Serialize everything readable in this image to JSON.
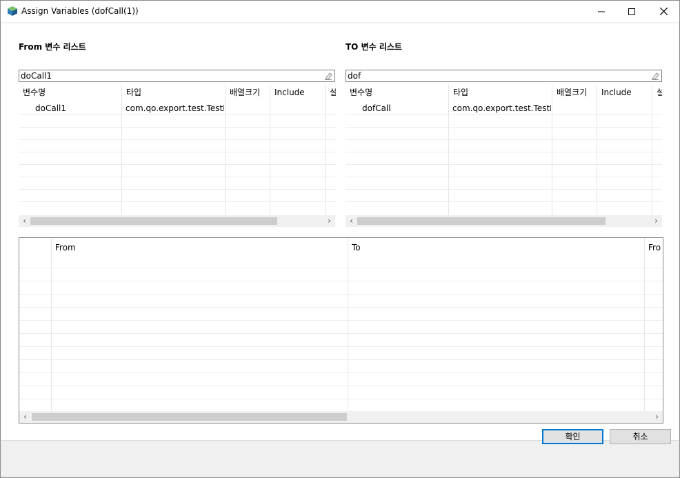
{
  "window": {
    "title": "Assign Variables (dofCall(1))",
    "minimize": "—",
    "maximize": "☐",
    "close": "✕"
  },
  "from_panel": {
    "title": "From 변수 리스트",
    "filter_value": "doCall1",
    "columns": [
      "변수명",
      "타입",
      "배열크기",
      "Include",
      "설"
    ],
    "rows": [
      {
        "name": "doCall1",
        "type": "com.qo.export.test.TestDo",
        "array_size": "",
        "include": ""
      }
    ]
  },
  "to_panel": {
    "title": "TO 변수 리스트",
    "filter_value": "dof",
    "columns": [
      "변수명",
      "타입",
      "배열크기",
      "Include",
      "설"
    ],
    "rows": [
      {
        "name": "dofCall",
        "type": "com.qo.export.test.TestD...",
        "array_size": "",
        "include": ""
      }
    ]
  },
  "mapping_grid": {
    "columns": [
      "",
      "From",
      "To",
      "Fro"
    ]
  },
  "scroll_arrows": {
    "left": "‹",
    "right": "›"
  },
  "buttons": {
    "ok": "확인",
    "cancel": "취소"
  },
  "colors": {
    "accent": "#0078d7",
    "window_bg": "#f0f0f0",
    "scroll_thumb": "#cdcdcd"
  }
}
